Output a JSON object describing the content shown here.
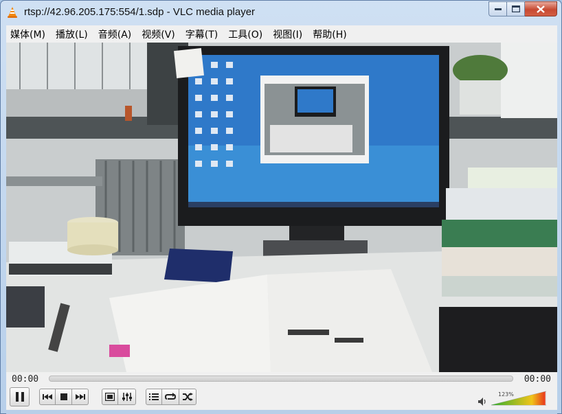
{
  "window": {
    "title": "rtsp://42.96.205.175:554/1.sdp - VLC media player"
  },
  "menubar": {
    "items": [
      "媒体(M)",
      "播放(L)",
      "音频(A)",
      "视频(V)",
      "字幕(T)",
      "工具(O)",
      "视图(I)",
      "帮助(H)"
    ]
  },
  "video": {
    "description_icon": "video-frame-image"
  },
  "playback": {
    "elapsed": "00:00",
    "total": "00:00",
    "volume_percent": "123%",
    "volume_level": 1.23,
    "progress": 0
  },
  "colors": {
    "accent_volume_start": "#2fae2f",
    "accent_volume_end": "#e8361b",
    "close_button": "#c74a32"
  },
  "icons": [
    "vlc-cone-icon",
    "minimize-icon",
    "maximize-icon",
    "close-icon",
    "pause-icon",
    "previous-icon",
    "stop-icon",
    "next-icon",
    "fullscreen-icon",
    "extended-settings-icon",
    "playlist-icon",
    "loop-icon",
    "shuffle-icon",
    "speaker-icon"
  ]
}
